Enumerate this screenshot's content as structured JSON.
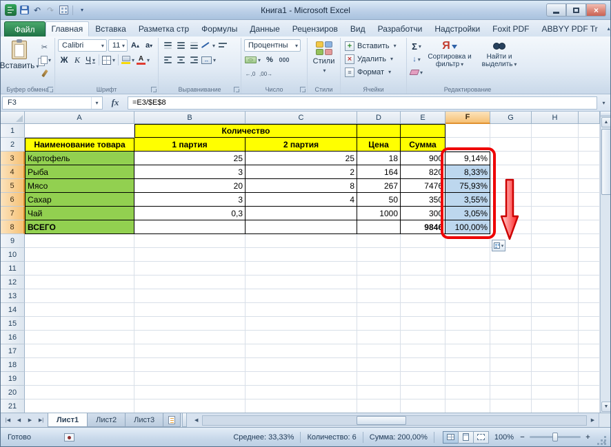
{
  "colors": {
    "header_yellow": "#ffff00",
    "product_green": "#92d050",
    "selection_blue": "#bdd7ee",
    "annotation_red": "#ee0000",
    "file_tab_green": "#1e7145",
    "column_highlight": "#f6c175"
  },
  "icons": {
    "dropdown": "▾",
    "undo": "↶",
    "redo": "↷",
    "help": "?",
    "close": "×",
    "scissors": "✂",
    "fill_down": "↓",
    "collapse_ribbon": "▴",
    "up_arrow": "▲",
    "down_arrow": "▼",
    "left_arrow": "◀",
    "right_arrow": "▶",
    "tab_first": "|◀",
    "tab_last": "▶|",
    "minus": "−",
    "plus": "+",
    "merge_arrows": "↔",
    "menu_lines": "≡"
  },
  "window": {
    "title": "Книга1  -  Microsoft Excel"
  },
  "ribbon_tabs": {
    "file": "Файл",
    "tabs": [
      "Главная",
      "Вставка",
      "Разметка стр",
      "Формулы",
      "Данные",
      "Рецензиров",
      "Вид",
      "Разработчи",
      "Надстройки",
      "Foxit PDF",
      "ABBYY PDF Tr"
    ],
    "active": "Главная"
  },
  "ribbon": {
    "clipboard": {
      "label": "Буфер обмена",
      "paste": "Вставить"
    },
    "font": {
      "label": "Шрифт",
      "family": "Calibri",
      "size": "11",
      "bold": "Ж",
      "italic": "К",
      "underline": "Ч",
      "grow": "А",
      "shrink": "а",
      "color_letter": "А"
    },
    "alignment": {
      "label": "Выравнивание"
    },
    "number": {
      "label": "Число",
      "format": "Процентны",
      "percent": "%",
      "thousands": "000",
      "dec_left": "←,0",
      "dec_right": ",00→"
    },
    "styles": {
      "label": "Стили",
      "button": "Стили"
    },
    "cells": {
      "label": "Ячейки",
      "insert": "Вставить",
      "del": "Удалить",
      "format": "Формат"
    },
    "editing": {
      "label": "Редактирование",
      "autosum": "Σ",
      "sort": "Сортировка и фильтр",
      "find": "Найти и выделить",
      "sort_letter": "Я"
    }
  },
  "formula_bar": {
    "name_box": "F3",
    "fx": "fx",
    "formula": "=E3/$E$8"
  },
  "grid": {
    "columns": [
      "A",
      "B",
      "C",
      "D",
      "E",
      "F",
      "G",
      "H"
    ],
    "row_count": 21,
    "selected_column": "F",
    "selection": "F3:F8",
    "active_cell": "F3",
    "table": {
      "quantity_header": "Количество",
      "header_row": [
        "Наименование товара",
        "1 партия",
        "2 партия",
        "Цена",
        "Сумма"
      ],
      "rows": [
        [
          "Картофель",
          "25",
          "25",
          "18",
          "900",
          "9,14%"
        ],
        [
          "Рыба",
          "3",
          "2",
          "164",
          "820",
          "8,33%"
        ],
        [
          "Мясо",
          "20",
          "8",
          "267",
          "7476",
          "75,93%"
        ],
        [
          "Сахар",
          "3",
          "4",
          "50",
          "350",
          "3,55%"
        ],
        [
          "Чай",
          "0,3",
          "",
          "1000",
          "300",
          "3,05%"
        ],
        [
          "ВСЕГО",
          "",
          "",
          "",
          "9846",
          "100,00%"
        ]
      ]
    }
  },
  "sheet_bar": {
    "tabs": [
      "Лист1",
      "Лист2",
      "Лист3"
    ],
    "active": "Лист1"
  },
  "status_bar": {
    "mode": "Готово",
    "average": "Среднее: 33,33%",
    "count": "Количество: 6",
    "sum": "Сумма: 200,00%",
    "zoom": "100%"
  }
}
